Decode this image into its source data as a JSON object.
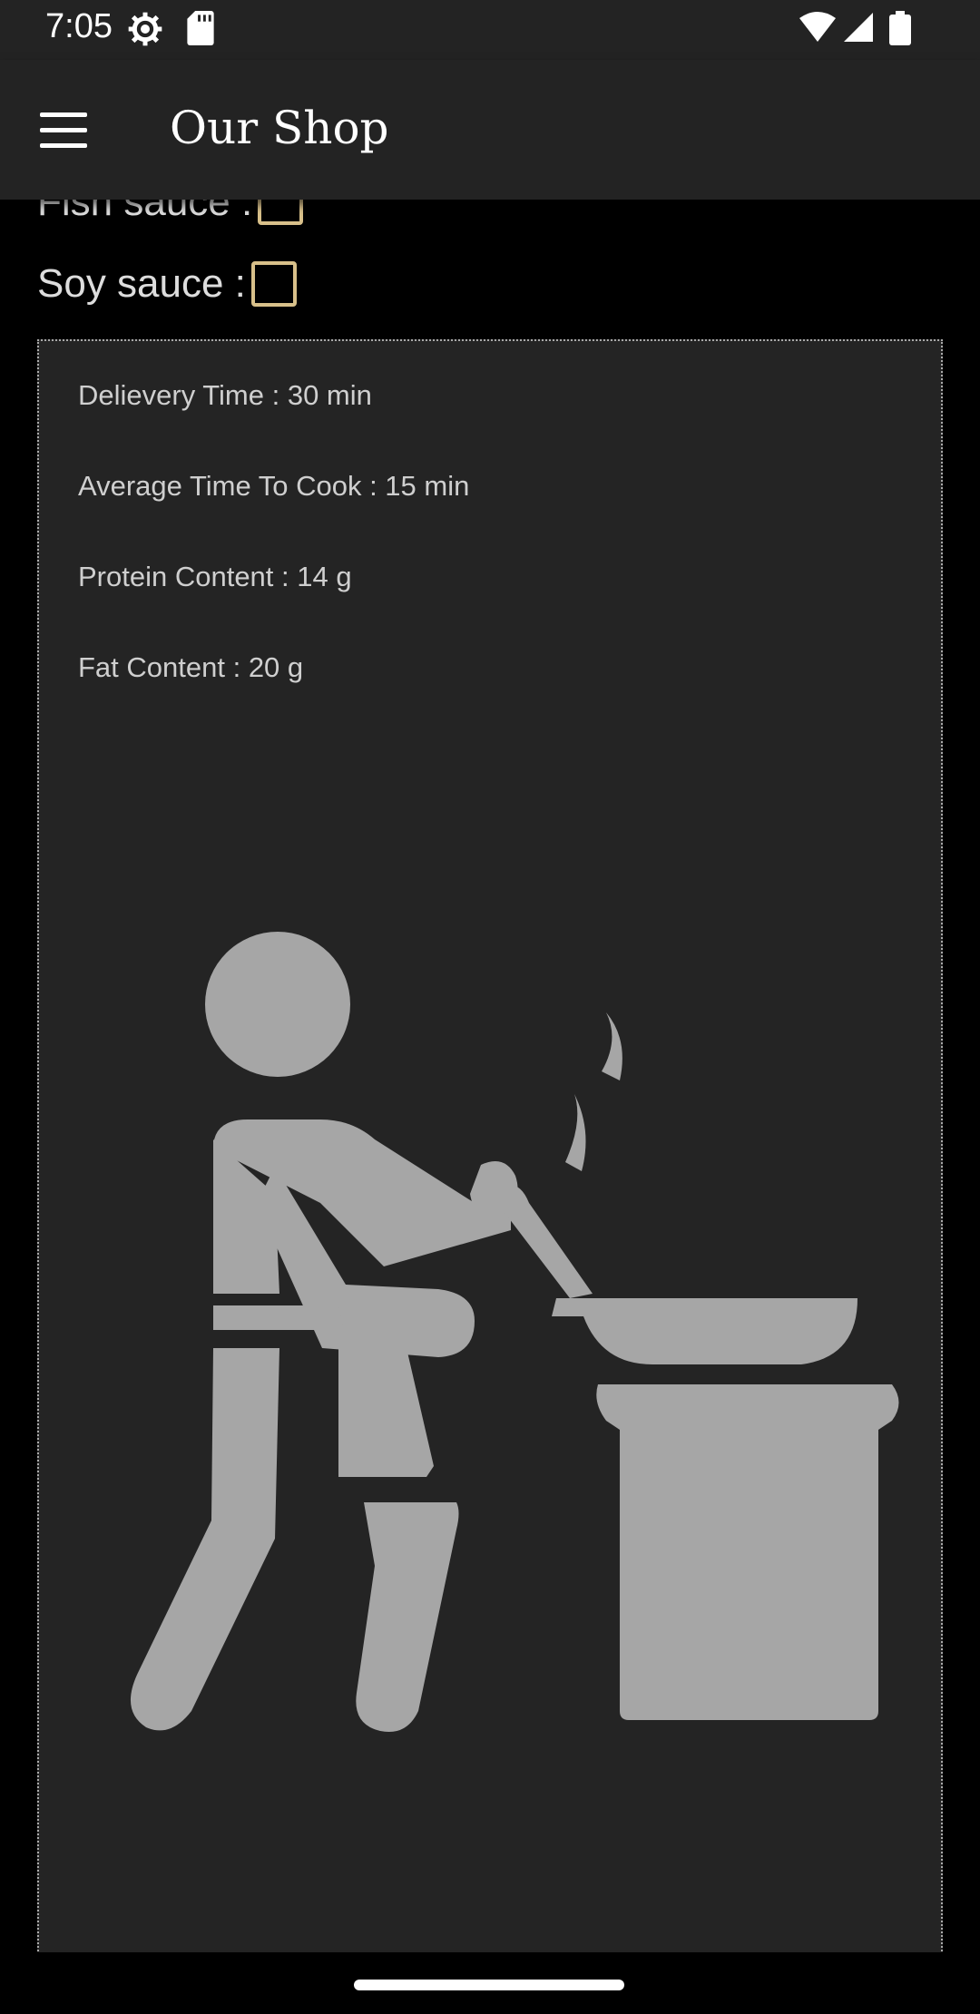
{
  "status_bar": {
    "time": "7:05",
    "icons": [
      "settings-icon",
      "sd-card-icon",
      "wifi-icon",
      "signal-icon",
      "battery-icon"
    ]
  },
  "app_bar": {
    "title": "Our Shop",
    "menu_icon": "hamburger-menu-icon"
  },
  "options": [
    {
      "label": "Fish sauce :",
      "checked": false
    },
    {
      "label": "Soy sauce :",
      "checked": false
    }
  ],
  "info": {
    "delivery_time": "Delievery Time : 30 min",
    "cook_time": "Average Time To Cook : 15 min",
    "protein": "Protein Content : 14 g",
    "fat": "Fat Content : 20 g"
  },
  "illustration": "person-cooking-icon",
  "colors": {
    "bar_background": "#232323",
    "card_background": "#242424",
    "checkbox_border": "#d8c08a",
    "illustration_fill": "#a6a6a6"
  }
}
